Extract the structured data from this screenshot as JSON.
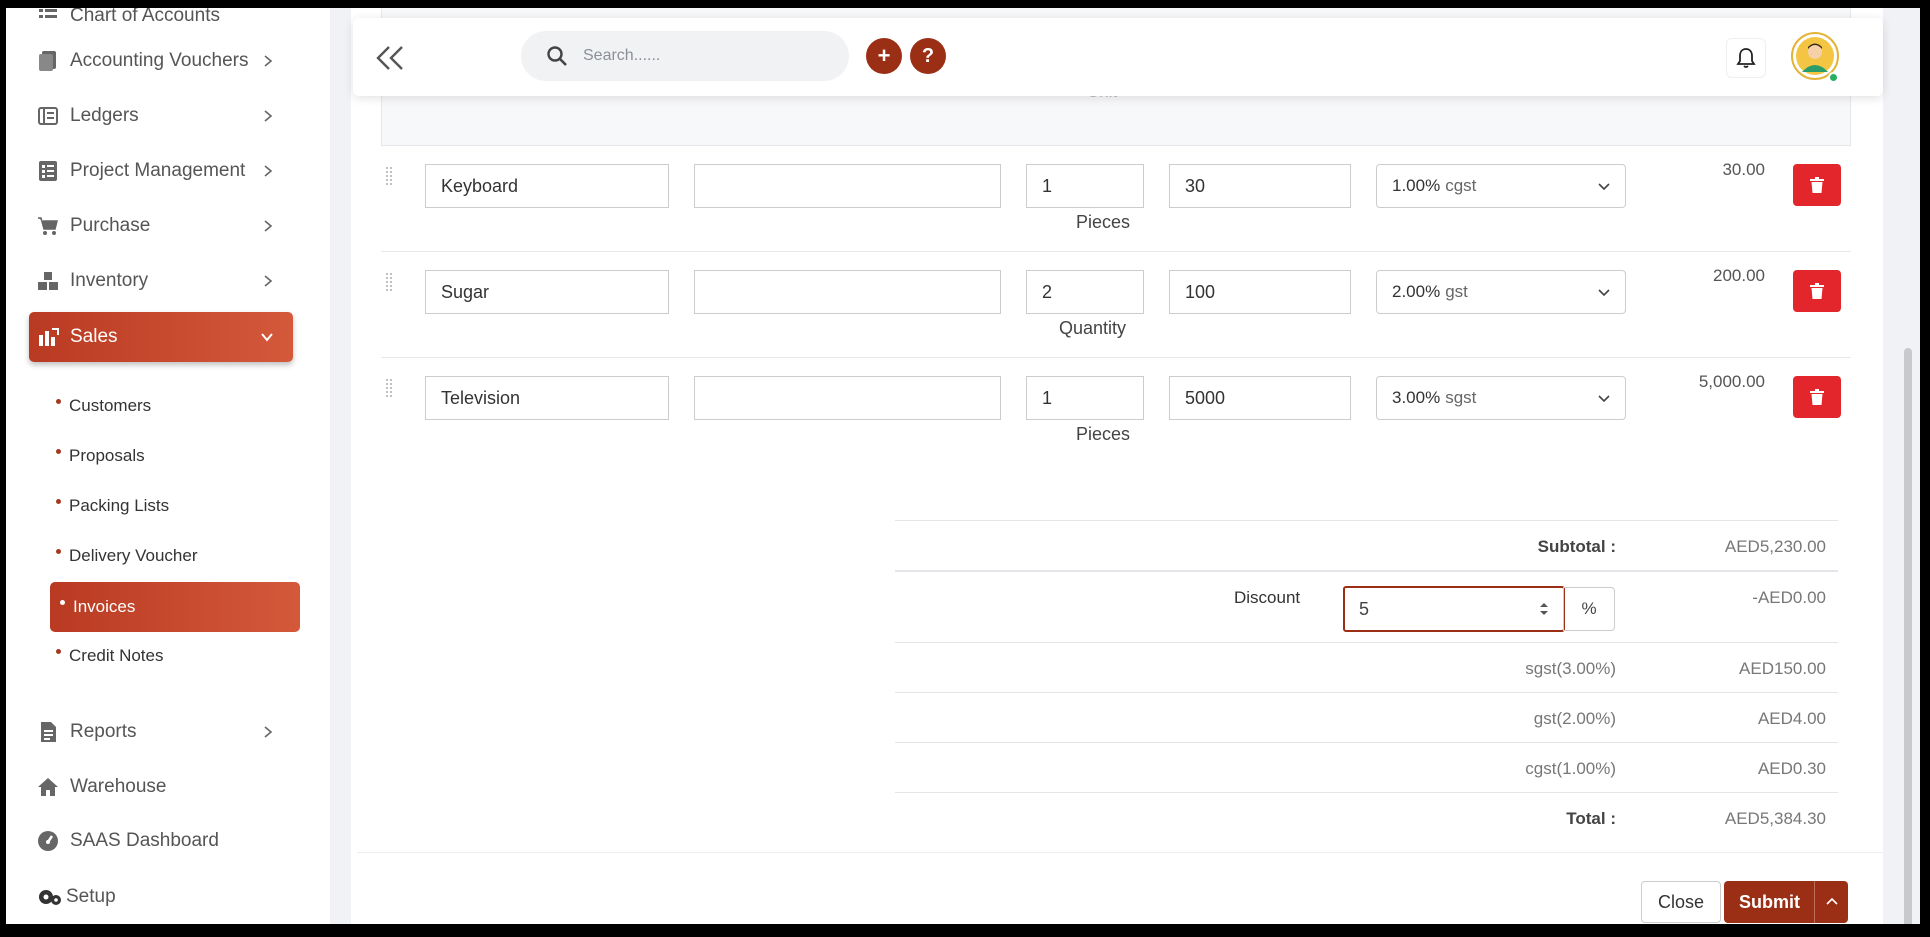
{
  "sidebar": {
    "items": [
      {
        "label": "Chart of Accounts",
        "icon": "list-icon"
      },
      {
        "label": "Accounting Vouchers",
        "icon": "voucher-icon"
      },
      {
        "label": "Ledgers",
        "icon": "ledger-icon"
      },
      {
        "label": "Project Management",
        "icon": "project-icon"
      },
      {
        "label": "Purchase",
        "icon": "cart-icon"
      },
      {
        "label": "Inventory",
        "icon": "boxes-icon"
      },
      {
        "label": "Sales",
        "icon": "sales-chart-icon"
      },
      {
        "label": "Reports",
        "icon": "report-icon"
      },
      {
        "label": "Warehouse",
        "icon": "home-icon"
      },
      {
        "label": "SAAS Dashboard",
        "icon": "gauge-icon"
      },
      {
        "label": "Setup",
        "icon": "cogs-icon"
      }
    ],
    "sales_sub": [
      "Customers",
      "Proposals",
      "Packing Lists",
      "Delivery Voucher",
      "Invoices",
      "Credit Notes"
    ]
  },
  "topbar": {
    "search_placeholder": "Search......",
    "add_symbol": "+",
    "help_symbol": "?"
  },
  "table": {
    "unit_header": "Unit",
    "rows": [
      {
        "item": "Keyboard",
        "description": "",
        "qty": "1",
        "rate": "30",
        "tax_rate": "1.00%",
        "tax_name": "cgst",
        "unit": "Pieces",
        "amount": "30.00"
      },
      {
        "item": "Sugar",
        "description": "",
        "qty": "2",
        "rate": "100",
        "tax_rate": "2.00%",
        "tax_name": "gst",
        "unit": "Quantity",
        "amount": "200.00"
      },
      {
        "item": "Television",
        "description": "",
        "qty": "1",
        "rate": "5000",
        "tax_rate": "3.00%",
        "tax_name": "sgst",
        "unit": "Pieces",
        "amount": "5,000.00"
      }
    ]
  },
  "totals": {
    "subtotal_label": "Subtotal :",
    "subtotal_value": "AED5,230.00",
    "discount_label": "Discount",
    "discount_input": "5",
    "discount_type": "%",
    "discount_value": "-AED0.00",
    "taxes": [
      {
        "label": "sgst(3.00%)",
        "value": "AED150.00"
      },
      {
        "label": "gst(2.00%)",
        "value": "AED4.00"
      },
      {
        "label": "cgst(1.00%)",
        "value": "AED0.30"
      }
    ],
    "total_label": "Total :",
    "total_value": "AED5,384.30"
  },
  "footer": {
    "close_label": "Close",
    "submit_label": "Submit"
  },
  "colors": {
    "brand": "#9b2f16",
    "active_gradient_start": "#b93a22",
    "active_gradient_end": "#d4593b",
    "delete": "#e3252c"
  }
}
